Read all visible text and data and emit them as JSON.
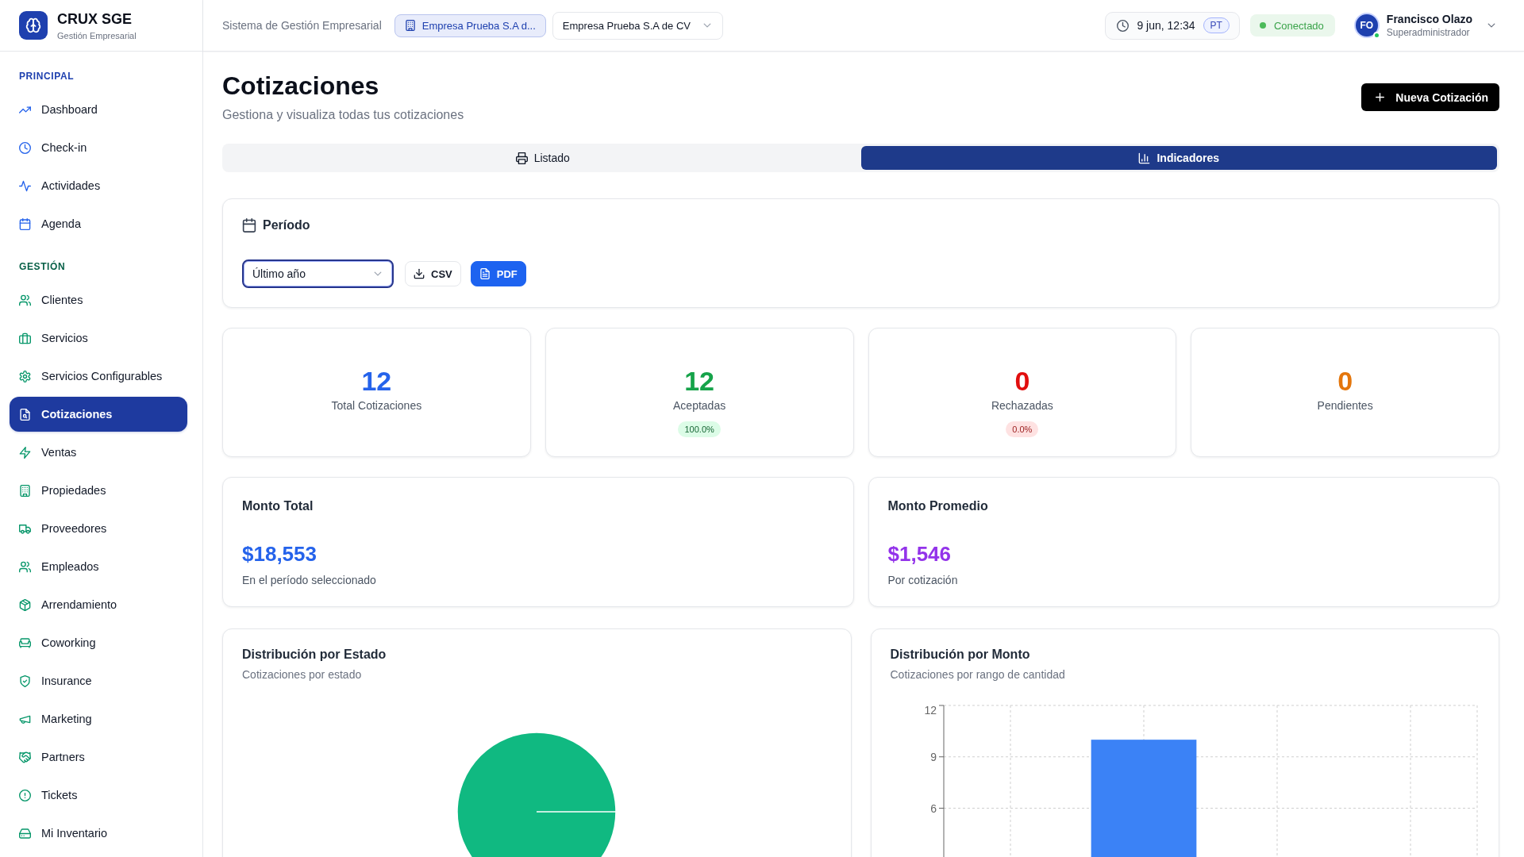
{
  "sidebar": {
    "brand": {
      "name": "CRUX SGE",
      "subtitle": "Gestión Empresarial"
    },
    "sections": [
      {
        "title": "PRINCIPAL",
        "items": [
          {
            "label": "Dashboard",
            "selected": false
          },
          {
            "label": "Check-in",
            "selected": false
          },
          {
            "label": "Actividades",
            "selected": false
          },
          {
            "label": "Agenda",
            "selected": false
          }
        ]
      },
      {
        "title": "GESTIÓN",
        "items": [
          {
            "label": "Clientes",
            "selected": false
          },
          {
            "label": "Servicios",
            "selected": false
          },
          {
            "label": "Servicios Configurables",
            "selected": false
          },
          {
            "label": "Cotizaciones",
            "selected": true
          },
          {
            "label": "Ventas",
            "selected": false
          },
          {
            "label": "Propiedades",
            "selected": false
          },
          {
            "label": "Proveedores",
            "selected": false
          },
          {
            "label": "Empleados",
            "selected": false
          },
          {
            "label": "Arrendamiento",
            "selected": false
          },
          {
            "label": "Coworking",
            "selected": false
          },
          {
            "label": "Insurance",
            "selected": false
          },
          {
            "label": "Marketing",
            "selected": false
          },
          {
            "label": "Partners",
            "selected": false
          },
          {
            "label": "Tickets",
            "selected": false
          },
          {
            "label": "Mi Inventario",
            "selected": false
          }
        ]
      }
    ]
  },
  "top_bar": {
    "system_name": "Sistema de Gestión Empresarial",
    "company_badge": "Empresa Prueba S.A d...",
    "company_select": {
      "value": "Empresa Prueba S.A de CV"
    },
    "datetime": "9 jun, 12:34",
    "timezone": "PT",
    "connection": {
      "label": "Conectado",
      "connected": true
    },
    "user": {
      "initials": "FO",
      "name": "Francisco Olazo",
      "role": "Superadministrador",
      "online": true
    }
  },
  "page": {
    "title": "Cotizaciones",
    "subtitle": "Gestiona y visualiza todas tus cotizaciones",
    "primary_button": "Nueva Cotización"
  },
  "tabs": [
    {
      "label": "Listado",
      "selected": false
    },
    {
      "label": "Indicadores",
      "selected": true
    }
  ],
  "period": {
    "title": "Período",
    "select": {
      "value": "Último año",
      "focused": true
    },
    "buttons": [
      {
        "label": "CSV",
        "kind": "outline"
      },
      {
        "label": "PDF",
        "kind": "primary"
      }
    ]
  },
  "stats": [
    {
      "value": "12",
      "label": "Total Cotizaciones",
      "color": "#2563eb"
    },
    {
      "value": "12",
      "label": "Aceptadas",
      "color": "#16a34a",
      "badge": {
        "text": "100.0%",
        "kind": "success"
      }
    },
    {
      "value": "0",
      "label": "Rechazadas",
      "color": "#e10e0e",
      "badge": {
        "text": "0.0%",
        "kind": "danger"
      }
    },
    {
      "value": "0",
      "label": "Pendientes",
      "color": "#e4760c"
    }
  ],
  "amounts": [
    {
      "title": "Monto Total",
      "value": "$18,553",
      "caption": "En el período seleccionado",
      "color": "#2563eb"
    },
    {
      "title": "Monto Promedio",
      "value": "$1,546",
      "caption": "Por cotización",
      "color": "#9333ea"
    }
  ],
  "charts": [
    {
      "title": "Distribución por Estado",
      "subtitle": "Cotizaciones por estado",
      "chart_data": {
        "type": "pie",
        "values": [
          100
        ]
      }
    },
    {
      "title": "Distribución por Monto",
      "subtitle": "Cotizaciones por rango de cantidad",
      "chart_data": {
        "type": "bar",
        "values": [
          0,
          10,
          0,
          0
        ],
        "ylim": [
          0,
          12
        ],
        "yticks": [
          6,
          9,
          12
        ],
        "grid": true
      }
    }
  ]
}
